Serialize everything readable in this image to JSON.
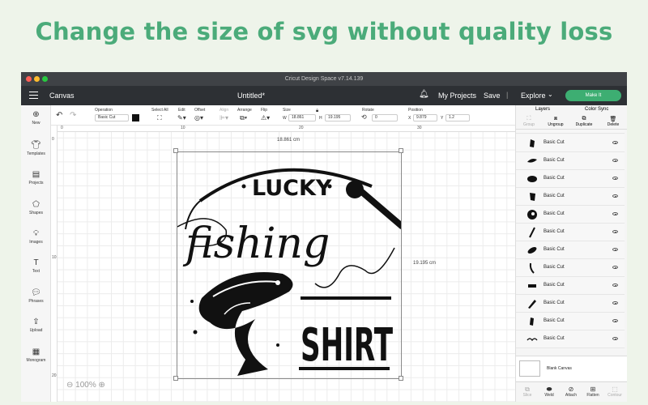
{
  "headline": "Change the size of svg without quality loss",
  "window": {
    "title": "Cricut Design Space  v7.14.139"
  },
  "topbar": {
    "canvas_label": "Canvas",
    "doc_title": "Untitled*",
    "my_projects": "My Projects",
    "save": "Save",
    "explore": "Explore",
    "make_it": "Make It"
  },
  "toolbar": {
    "operation_label": "Operation",
    "operation_value": "Basic Cut",
    "select_all": "Select All",
    "edit": "Edit",
    "offset": "Offset",
    "align": "Align",
    "arrange": "Arrange",
    "flip": "Flip",
    "size": "Size",
    "w_label": "W",
    "w_value": "18.861",
    "h_label": "H",
    "h_value": "19.195",
    "rotate": "Rotate",
    "rotate_value": "0",
    "position": "Position",
    "x_label": "X",
    "x_value": "9.879",
    "y_label": "Y",
    "y_value": "1.2"
  },
  "sidebar": [
    {
      "label": "New",
      "icon": "plus-icon"
    },
    {
      "label": "Templates",
      "icon": "shirt-icon"
    },
    {
      "label": "Projects",
      "icon": "projects-icon"
    },
    {
      "label": "Shapes",
      "icon": "shapes-icon"
    },
    {
      "label": "Images",
      "icon": "bulb-icon"
    },
    {
      "label": "Text",
      "icon": "text-icon"
    },
    {
      "label": "Phrases",
      "icon": "chat-icon"
    },
    {
      "label": "Upload",
      "icon": "upload-icon"
    },
    {
      "label": "Monogram",
      "icon": "monogram-icon"
    }
  ],
  "rulers": {
    "top": [
      "0",
      "10",
      "20",
      "30"
    ],
    "left": [
      "0",
      "10",
      "20"
    ]
  },
  "design": {
    "width_label": "18.861 cm",
    "height_label": "19.195 cm",
    "word1": "LUCKY",
    "word2": "fishing",
    "word3": "SHIRT"
  },
  "zoom": "100%",
  "panel": {
    "tab_layers": "Layers",
    "tab_color_sync": "Color Sync",
    "group": "Group",
    "ungroup": "Ungroup",
    "duplicate": "Duplicate",
    "delete": "Delete",
    "layers": [
      "Basic Cut",
      "Basic Cut",
      "Basic Cut",
      "Basic Cut",
      "Basic Cut",
      "Basic Cut",
      "Basic Cut",
      "Basic Cut",
      "Basic Cut",
      "Basic Cut",
      "Basic Cut",
      "Basic Cut"
    ],
    "blank_canvas": "Blank Canvas",
    "bottom": [
      "Slice",
      "Weld",
      "Attach",
      "Flatten",
      "Contour"
    ]
  },
  "colors": {
    "accent": "#4bab7a",
    "make_it": "#3dae72",
    "topbar": "#2d3034"
  }
}
